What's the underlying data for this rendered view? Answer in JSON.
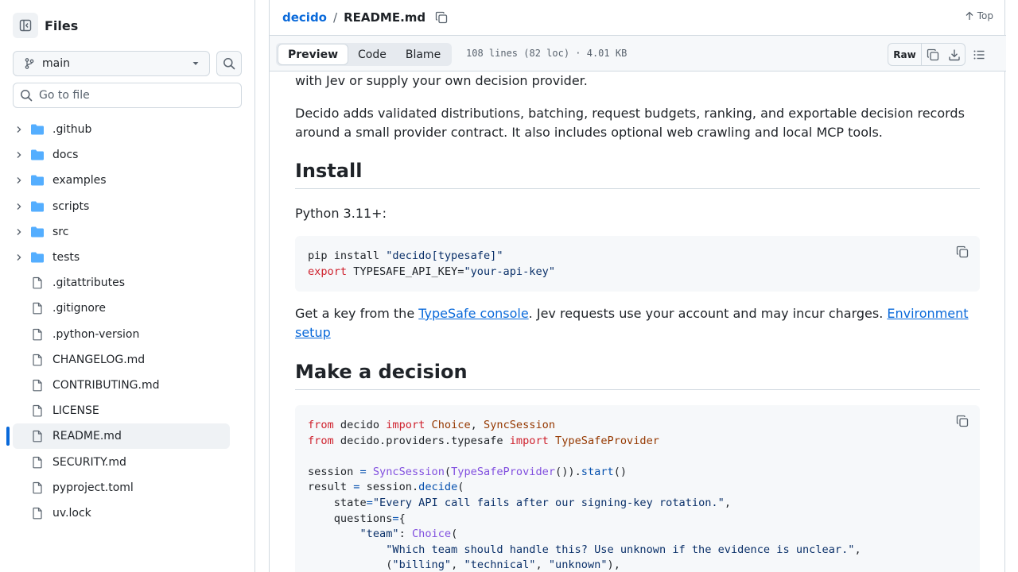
{
  "sidebar": {
    "title": "Files",
    "branch": "main",
    "goto_placeholder": "Go to file",
    "tree": [
      {
        "name": ".github",
        "type": "folder"
      },
      {
        "name": "docs",
        "type": "folder"
      },
      {
        "name": "examples",
        "type": "folder"
      },
      {
        "name": "scripts",
        "type": "folder"
      },
      {
        "name": "src",
        "type": "folder"
      },
      {
        "name": "tests",
        "type": "folder"
      },
      {
        "name": ".gitattributes",
        "type": "file"
      },
      {
        "name": ".gitignore",
        "type": "file"
      },
      {
        "name": ".python-version",
        "type": "file"
      },
      {
        "name": "CHANGELOG.md",
        "type": "file"
      },
      {
        "name": "CONTRIBUTING.md",
        "type": "file"
      },
      {
        "name": "LICENSE",
        "type": "file"
      },
      {
        "name": "README.md",
        "type": "file",
        "selected": true
      },
      {
        "name": "SECURITY.md",
        "type": "file"
      },
      {
        "name": "pyproject.toml",
        "type": "file"
      },
      {
        "name": "uv.lock",
        "type": "file"
      }
    ]
  },
  "header": {
    "repo": "decido",
    "separator": "/",
    "file": "README.md",
    "top_label": "Top"
  },
  "filebar": {
    "tabs": [
      "Preview",
      "Code",
      "Blame"
    ],
    "active_tab": "Preview",
    "info": "108 lines (82 loc) · 4.01 KB",
    "raw_label": "Raw"
  },
  "content": {
    "p1": "with Jev or supply your own decision provider.",
    "p2": "Decido adds validated distributions, batching, request budgets, ranking, and exportable decision records around a small provider contract. It also includes optional web crawling and local MCP tools.",
    "h_install": "Install",
    "p3": "Python 3.11+:",
    "p4_pre": "Get a key from the ",
    "p4_link1": "TypeSafe console",
    "p4_mid": ". Jev requests use your account and may incur charges. ",
    "p4_link2": "Environment setup",
    "h_decision": "Make a decision"
  },
  "code_install": [
    "pip install \"decido[typesafe]\"",
    "export TYPESAFE_API_KEY=\"your-api-key\""
  ],
  "code_decision": [
    "from decido import Choice, SyncSession",
    "from decido.providers.typesafe import TypeSafeProvider",
    "",
    "session = SyncSession(TypeSafeProvider()).start()",
    "result = session.decide(",
    "    state=\"Every API call fails after our signing-key rotation.\",",
    "    questions={",
    "        \"team\": Choice(",
    "            \"Which team should handle this? Use unknown if the evidence is unclear.\",",
    "            (\"billing\", \"technical\", \"unknown\"),"
  ],
  "colors": {
    "accent": "#0969da",
    "keyword": "#cf222e",
    "string": "#0a3069",
    "function": "#8250df",
    "class": "#953800",
    "operator": "#0550ae",
    "folder": "#54aeff"
  }
}
